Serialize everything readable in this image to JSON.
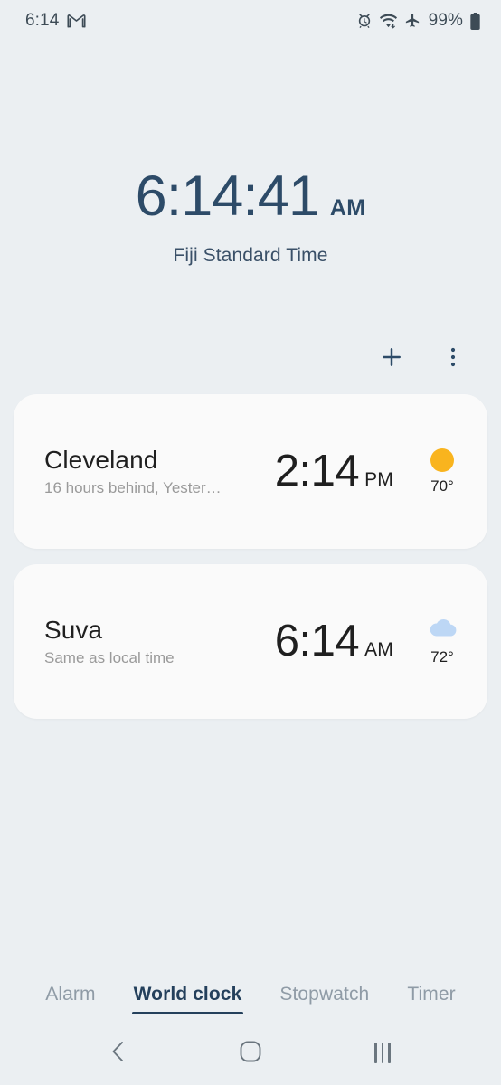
{
  "status_bar": {
    "time": "6:14",
    "app_icon": "gmail-icon",
    "icons": [
      "alarm-icon",
      "wifi-icon",
      "airplane-mode-icon"
    ],
    "battery_percent": "99%",
    "battery_icon": "battery-icon"
  },
  "hero": {
    "time": "6:14:41",
    "meridiem": "AM",
    "timezone": "Fiji Standard Time"
  },
  "actions": {
    "add_label": "add-city",
    "add_icon": "plus-icon",
    "more_label": "more-options",
    "more_icon": "overflow-menu-icon"
  },
  "cities": [
    {
      "name": "Cleveland",
      "offset": "16 hours behind, Yester…",
      "time": "2:14",
      "meridiem": "PM",
      "weather_icon": "sun-icon",
      "weather_color": "#f9b41e",
      "temperature": "70°"
    },
    {
      "name": "Suva",
      "offset": "Same as local time",
      "time": "6:14",
      "meridiem": "AM",
      "weather_icon": "cloud-icon",
      "weather_color": "#bdd7f5",
      "temperature": "72°"
    }
  ],
  "tabs": [
    {
      "label": "Alarm",
      "active": false
    },
    {
      "label": "World clock",
      "active": true
    },
    {
      "label": "Stopwatch",
      "active": false
    },
    {
      "label": "Timer",
      "active": false
    }
  ],
  "nav_bar": {
    "back": "back-icon",
    "home": "home-icon",
    "recents": "recents-icon"
  },
  "colors": {
    "background": "#ebeff2",
    "card": "#fafafa",
    "accent": "#24405c",
    "muted": "#9a9a9a"
  }
}
